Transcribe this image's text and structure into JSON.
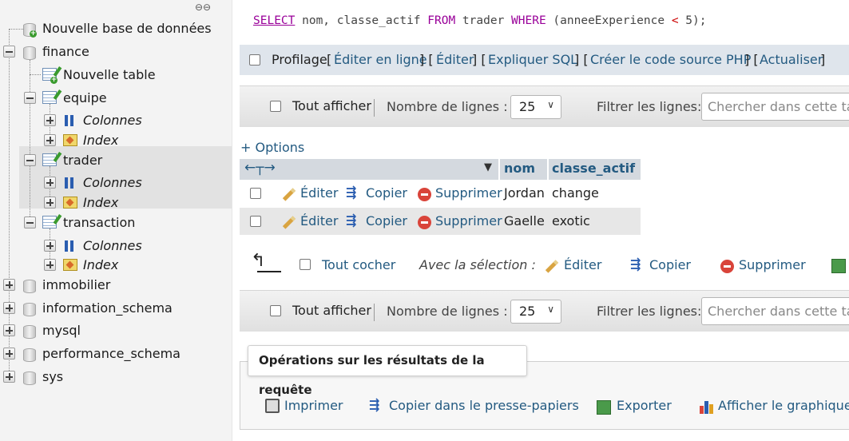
{
  "sidebar": {
    "items": [
      {
        "label": "Nouvelle base de données"
      },
      {
        "label": "finance"
      },
      {
        "label": "Nouvelle table"
      },
      {
        "label": "equipe"
      },
      {
        "label": "Colonnes"
      },
      {
        "label": "Index"
      },
      {
        "label": "trader"
      },
      {
        "label": "Colonnes"
      },
      {
        "label": "Index"
      },
      {
        "label": "transaction"
      },
      {
        "label": "Colonnes"
      },
      {
        "label": "Index"
      },
      {
        "label": "immobilier"
      },
      {
        "label": "information_schema"
      },
      {
        "label": "mysql"
      },
      {
        "label": "performance_schema"
      },
      {
        "label": "sys"
      }
    ]
  },
  "query": {
    "select": "SELECT",
    "cols": " nom, classe_actif ",
    "from": "FROM",
    "table": " trader ",
    "where": "WHERE",
    "open": " (anneeExperience ",
    "lt": "<",
    "rest": " 5);"
  },
  "profiling": {
    "label": "Profilage",
    "links": [
      "Éditer en ligne",
      "Éditer",
      "Expliquer SQL",
      "Créer le code source PHP",
      "Actualiser"
    ]
  },
  "nav": {
    "show_all": "Tout afficher",
    "rows_label": "Nombre de lignes :",
    "rows_value": "25",
    "filter_label": "Filtrer les lignes:",
    "filter_placeholder": "Chercher dans cette table"
  },
  "options_link": "+ Options",
  "table": {
    "columns": [
      "nom",
      "classe_actif"
    ],
    "rows": [
      {
        "nom": "Jordan",
        "classe_actif": "change"
      },
      {
        "nom": "Gaelle",
        "classe_actif": "exotic"
      }
    ],
    "actions": {
      "edit": "Éditer",
      "copy": "Copier",
      "delete": "Supprimer"
    }
  },
  "bulk": {
    "check_all": "Tout cocher",
    "with_selection": "Avec la sélection :",
    "edit": "Éditer",
    "copy": "Copier",
    "delete": "Supprimer"
  },
  "operations": {
    "title": "Opérations sur les résultats de la requête",
    "print": "Imprimer",
    "copy_clipboard": "Copier dans le presse-papiers",
    "export": "Exporter",
    "chart": "Afficher le graphique"
  },
  "colors": {
    "link": "#235a81",
    "keyword": "#990099",
    "operator": "#cc0000"
  }
}
